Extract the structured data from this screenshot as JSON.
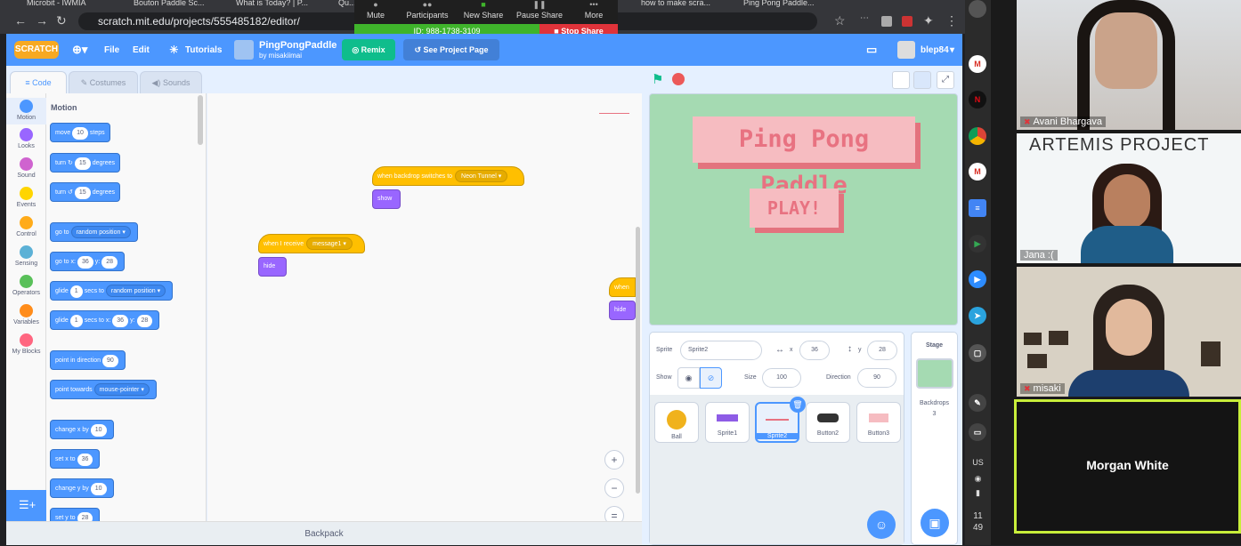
{
  "browser": {
    "tabs": [
      "Microbit - IWMIA",
      "Bouton Paddle Sc...",
      "What is Today? | P...",
      "Qu...",
      "how to make scra...",
      "Ping Pong Paddle..."
    ],
    "url": "scratch.mit.edu/projects/555485182/editor/"
  },
  "zoom_bar": {
    "items": [
      "Mute",
      "Participants",
      "New Share",
      "Pause Share",
      "More"
    ],
    "meeting_id": "ID: 988-1738-3109",
    "stop_share": "Stop Share"
  },
  "scratch_menu": {
    "logo": "SCRATCH",
    "file": "File",
    "edit": "Edit",
    "tutorials": "Tutorials",
    "project_title": "PingPongPaddle",
    "project_author": "by misakiimai",
    "remix": "Remix",
    "see_project_page": "See Project Page",
    "username": "blep84"
  },
  "editor_tabs": {
    "code": "Code",
    "costumes": "Costumes",
    "sounds": "Sounds"
  },
  "categories": [
    {
      "label": "Motion",
      "color": "#4c97ff"
    },
    {
      "label": "Looks",
      "color": "#9966ff"
    },
    {
      "label": "Sound",
      "color": "#cf63cf"
    },
    {
      "label": "Events",
      "color": "#ffd500"
    },
    {
      "label": "Control",
      "color": "#ffab19"
    },
    {
      "label": "Sensing",
      "color": "#5cb1d6"
    },
    {
      "label": "Operators",
      "color": "#59c059"
    },
    {
      "label": "Variables",
      "color": "#ff8c1a"
    },
    {
      "label": "My Blocks",
      "color": "#ff6680"
    }
  ],
  "palette": {
    "header": "Motion",
    "move": {
      "a": "move",
      "v": "10",
      "b": "steps"
    },
    "turn_right": {
      "a": "turn",
      "v": "15",
      "b": "degrees"
    },
    "turn_left": {
      "a": "turn",
      "v": "15",
      "b": "degrees"
    },
    "go_to": {
      "a": "go to",
      "d": "random position"
    },
    "go_to_xy": {
      "a": "go to x:",
      "x": "36",
      "b": "y:",
      "y": "28"
    },
    "glide_to": {
      "a": "glide",
      "v": "1",
      "b": "secs to",
      "d": "random position"
    },
    "glide_xy": {
      "a": "glide",
      "v": "1",
      "b": "secs to x:",
      "x": "36",
      "c": "y:",
      "y": "28"
    },
    "point_dir": {
      "a": "point in direction",
      "v": "90"
    },
    "point_towards": {
      "a": "point towards",
      "d": "mouse-pointer"
    },
    "change_x": {
      "a": "change x by",
      "v": "10"
    },
    "set_x": {
      "a": "set x to",
      "v": "36"
    },
    "change_y": {
      "a": "change y by",
      "v": "10"
    },
    "set_y": {
      "a": "set y to",
      "v": "28"
    }
  },
  "scripts": {
    "backdrop_hat": "when backdrop switches to",
    "backdrop_value": "Neon Tunnel",
    "show": "show",
    "receive_hat": "when I receive",
    "receive_value": "message1",
    "hide": "hide",
    "partial_hat": "when",
    "partial_hide": "hide"
  },
  "backpack": "Backpack",
  "stage": {
    "title": "Ping Pong Paddle",
    "play": "PLAY!"
  },
  "sprite_info": {
    "sprite_label": "Sprite",
    "sprite_name": "Sprite2",
    "x_label": "x",
    "x": "36",
    "y_label": "y",
    "y": "28",
    "show_label": "Show",
    "size_label": "Size",
    "size": "100",
    "direction_label": "Direction",
    "direction": "90"
  },
  "sprites": [
    "Ball",
    "Sprite1",
    "Sprite2",
    "Button2",
    "Button3"
  ],
  "stage_pane": {
    "title": "Stage",
    "backdrops_label": "Backdrops",
    "backdrops_count": "3"
  },
  "taskbar": {
    "lang": "US",
    "time_h": "11",
    "time_m": "49"
  },
  "participants": [
    "Avani Bhargava",
    "Jana :(",
    "misaki",
    "Morgan White"
  ],
  "jana_banner": "ARTEMIS PROJECT"
}
